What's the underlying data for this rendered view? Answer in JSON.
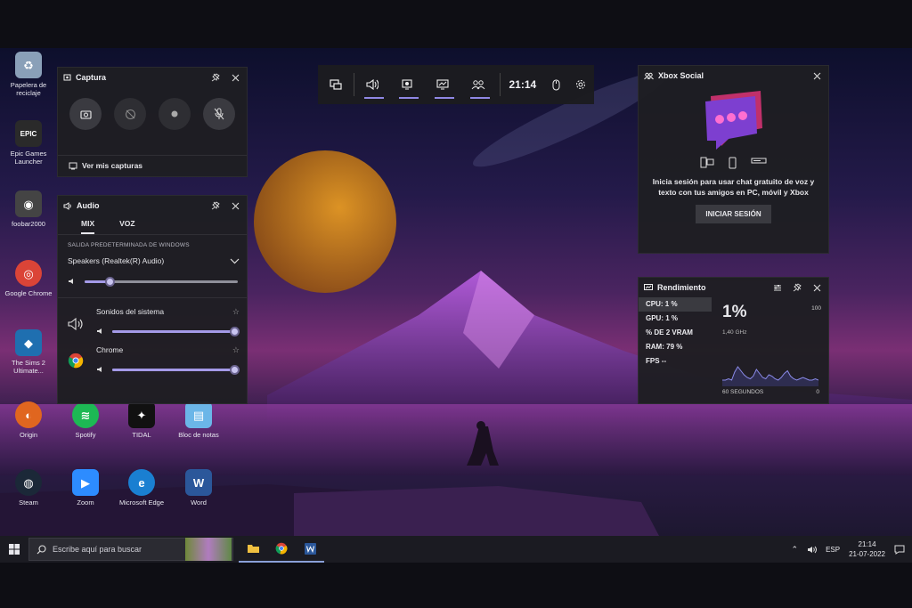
{
  "desktop_icons": [
    {
      "label": "Papelera de reciclaje",
      "color": "#8aa0b8",
      "glyph": "♻"
    },
    {
      "label": "Epic Games Launcher",
      "color": "#2a2a2a",
      "glyph": "EPIC"
    },
    {
      "label": "foobar2000",
      "color": "#444",
      "glyph": "◉"
    },
    {
      "label": "Google Chrome",
      "color": "#2a2a2a",
      "glyph": "◎"
    },
    {
      "label": "The Sims 2 Ultimate...",
      "color": "#1f6fb0",
      "glyph": "◆"
    },
    {
      "label": "Origin",
      "color": "#e0661f",
      "glyph": "◐"
    },
    {
      "label": "Spotify",
      "color": "#1db954",
      "glyph": "≋"
    },
    {
      "label": "TIDAL",
      "color": "#111",
      "glyph": "✦"
    },
    {
      "label": "Bloc de notas",
      "color": "#6bb6e8",
      "glyph": "▤"
    },
    {
      "label": "Steam",
      "color": "#1b2838",
      "glyph": "◍"
    },
    {
      "label": "Zoom",
      "color": "#2d8cff",
      "glyph": "▶"
    },
    {
      "label": "Microsoft Edge",
      "color": "#1a7fd1",
      "glyph": "e"
    },
    {
      "label": "Word",
      "color": "#2b579a",
      "glyph": "W"
    }
  ],
  "xbox_bar": {
    "time": "21:14",
    "widgets": [
      "widget-menu-icon",
      "audio-icon",
      "capture-icon",
      "performance-icon",
      "social-icon"
    ],
    "accent": "#8f88e4"
  },
  "capture": {
    "title": "Captura",
    "buttons": [
      "screenshot-icon",
      "record-last-icon",
      "record-icon",
      "mic-off-icon"
    ],
    "link": "Ver mis capturas"
  },
  "audio": {
    "title": "Audio",
    "tabs": [
      "MIX",
      "VOZ"
    ],
    "section_label": "SALIDA PREDETERMINADA DE WINDOWS",
    "device": "Speakers (Realtek(R) Audio)",
    "master_volume": 0.16,
    "apps": [
      {
        "name": "Sonidos del sistema",
        "volume": 1.0
      },
      {
        "name": "Chrome",
        "volume": 1.0
      }
    ]
  },
  "social": {
    "title": "Xbox Social",
    "message": "Inicia sesión para usar chat gratuito de voz y texto con tus amigos en PC, móvil y Xbox",
    "button": "INICIAR SESIÓN"
  },
  "performance": {
    "title": "Rendimiento",
    "metrics": [
      {
        "label": "CPU:",
        "value": "1 %"
      },
      {
        "label": "GPU:",
        "value": "1 %"
      },
      {
        "label": "% DE",
        "value": "2 VRAM"
      },
      {
        "label": "RAM:",
        "value": "79 %"
      },
      {
        "label": "FPS",
        "value": "--"
      }
    ],
    "big_value": "1%",
    "frequency": "1,40 GHz",
    "max_label": "100",
    "min_label": "0",
    "span_label": "60 SEGUNDOS",
    "graph": [
      2,
      2,
      3,
      2,
      8,
      12,
      9,
      6,
      4,
      3,
      5,
      10,
      7,
      4,
      3,
      6,
      5,
      3,
      2,
      4,
      7,
      9,
      5,
      3,
      2,
      3,
      4,
      3,
      2,
      2,
      3,
      2
    ]
  },
  "taskbar": {
    "search_placeholder": "Escribe aquí para buscar",
    "language": "ESP",
    "time": "21:14",
    "date": "21-07-2022"
  }
}
